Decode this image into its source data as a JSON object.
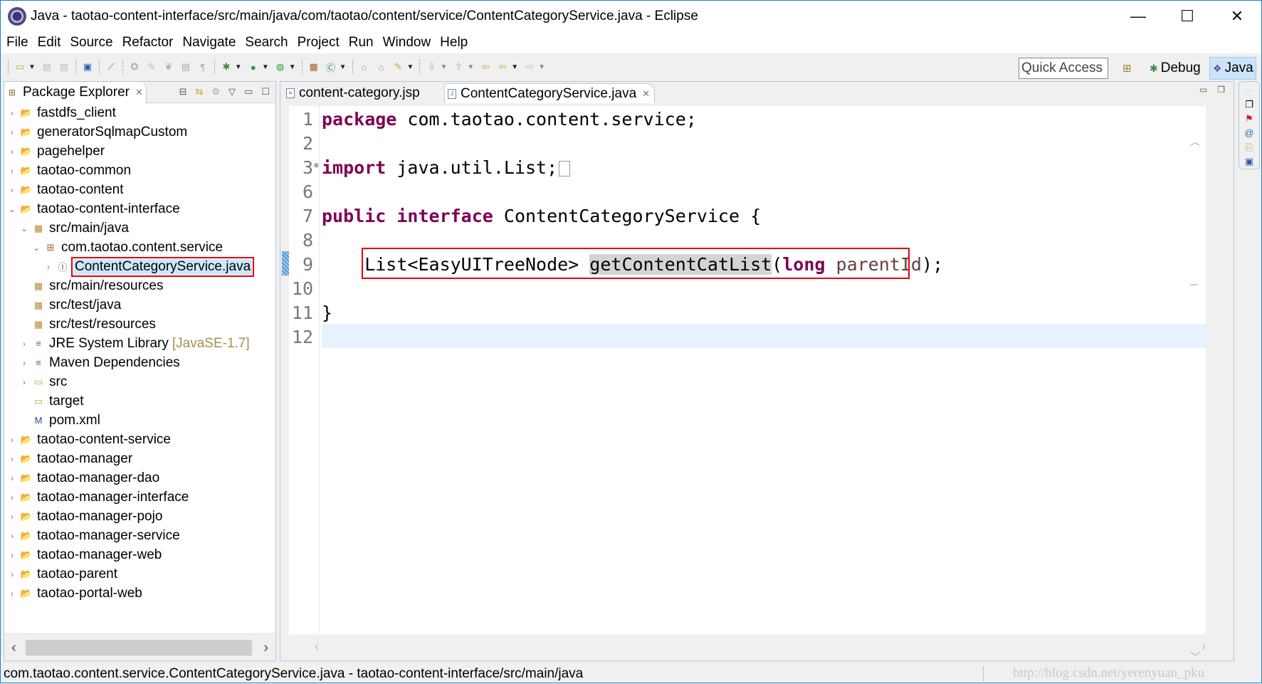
{
  "window": {
    "title": "Java - taotao-content-interface/src/main/java/com/taotao/content/service/ContentCategoryService.java - Eclipse",
    "minimize": "—",
    "maximize": "☐",
    "close": "✕"
  },
  "menu": [
    "File",
    "Edit",
    "Source",
    "Refactor",
    "Navigate",
    "Search",
    "Project",
    "Run",
    "Window",
    "Help"
  ],
  "toolbar": {
    "quick_access": "Quick Access",
    "perspectives": {
      "open": "⊞",
      "debug": "Debug",
      "java": "Java"
    }
  },
  "package_explorer": {
    "title": "Package Explorer",
    "tree": [
      {
        "label": "fastdfs_client",
        "level": 0,
        "expand": ">",
        "icon": "maven-project-warning"
      },
      {
        "label": "generatorSqlmapCustom",
        "level": 0,
        "expand": ">",
        "icon": "java-project-warning"
      },
      {
        "label": "pagehelper",
        "level": 0,
        "expand": ">",
        "icon": "maven-project"
      },
      {
        "label": "taotao-common",
        "level": 0,
        "expand": ">",
        "icon": "maven-project-warning"
      },
      {
        "label": "taotao-content",
        "level": 0,
        "expand": ">",
        "icon": "maven-project-warning"
      },
      {
        "label": "taotao-content-interface",
        "level": 0,
        "expand": "v",
        "icon": "maven-project"
      },
      {
        "label": "src/main/java",
        "level": 1,
        "expand": "v",
        "icon": "source-folder"
      },
      {
        "label": "com.taotao.content.service",
        "level": 2,
        "expand": "v",
        "icon": "package"
      },
      {
        "label": "ContentCategoryService.java",
        "level": 3,
        "expand": ">",
        "icon": "interface-file",
        "selected": true
      },
      {
        "label": "src/main/resources",
        "level": 1,
        "expand": "",
        "icon": "source-folder"
      },
      {
        "label": "src/test/java",
        "level": 1,
        "expand": "",
        "icon": "source-folder"
      },
      {
        "label": "src/test/resources",
        "level": 1,
        "expand": "",
        "icon": "source-folder"
      },
      {
        "label": "JRE System Library",
        "decoration": "[JavaSE-1.7]",
        "level": 1,
        "expand": ">",
        "icon": "library"
      },
      {
        "label": "Maven Dependencies",
        "level": 1,
        "expand": ">",
        "icon": "library"
      },
      {
        "label": "src",
        "level": 1,
        "expand": ">",
        "icon": "folder"
      },
      {
        "label": "target",
        "level": 1,
        "expand": "",
        "icon": "folder"
      },
      {
        "label": "pom.xml",
        "level": 1,
        "expand": "",
        "icon": "maven-file"
      },
      {
        "label": "taotao-content-service",
        "level": 0,
        "expand": ">",
        "icon": "maven-project-warning"
      },
      {
        "label": "taotao-manager",
        "level": 0,
        "expand": ">",
        "icon": "maven-project-warning"
      },
      {
        "label": "taotao-manager-dao",
        "level": 0,
        "expand": ">",
        "icon": "maven-project-warning"
      },
      {
        "label": "taotao-manager-interface",
        "level": 0,
        "expand": ">",
        "icon": "maven-project-warning"
      },
      {
        "label": "taotao-manager-pojo",
        "level": 0,
        "expand": ">",
        "icon": "maven-project-warning"
      },
      {
        "label": "taotao-manager-service",
        "level": 0,
        "expand": ">",
        "icon": "maven-project-warning"
      },
      {
        "label": "taotao-manager-web",
        "level": 0,
        "expand": ">",
        "icon": "maven-project-warning"
      },
      {
        "label": "taotao-parent",
        "level": 0,
        "expand": ">",
        "icon": "maven-project"
      },
      {
        "label": "taotao-portal-web",
        "level": 0,
        "expand": ">",
        "icon": "maven-project-warning"
      }
    ]
  },
  "editor": {
    "tabs": [
      {
        "label": "content-category.jsp",
        "active": false
      },
      {
        "label": "ContentCategoryService.java",
        "active": true
      }
    ],
    "lines": [
      {
        "num": "1",
        "tokens": [
          {
            "t": "package",
            "c": "kw"
          },
          {
            "t": " com.taotao.content.service;"
          }
        ]
      },
      {
        "num": "2",
        "tokens": []
      },
      {
        "num": "3",
        "fold": "⊕",
        "tokens": [
          {
            "t": "import",
            "c": "kw"
          },
          {
            "t": " java.util.List;"
          }
        ],
        "folded": true
      },
      {
        "num": "6",
        "tokens": []
      },
      {
        "num": "7",
        "tokens": [
          {
            "t": "public",
            "c": "kw"
          },
          {
            "t": " "
          },
          {
            "t": "interface",
            "c": "kw"
          },
          {
            "t": " ContentCategoryService {"
          }
        ]
      },
      {
        "num": "8",
        "tokens": []
      },
      {
        "num": "9",
        "tokens": [
          {
            "t": "    List<EasyUITreeNode> "
          },
          {
            "t": "getContentCatList",
            "c": "occurrence"
          },
          {
            "t": "("
          },
          {
            "t": "long",
            "c": "kw"
          },
          {
            "t": " "
          },
          {
            "t": "parentId",
            "c": "param"
          },
          {
            "t": ");"
          }
        ],
        "changed": true
      },
      {
        "num": "10",
        "tokens": []
      },
      {
        "num": "11",
        "tokens": [
          {
            "t": "}"
          }
        ]
      },
      {
        "num": "12",
        "tokens": [],
        "current": true
      }
    ]
  },
  "status_bar": {
    "text": "com.taotao.content.service.ContentCategoryService.java - taotao-content-interface/src/main/java",
    "watermark": "http://blog.csdn.net/yerenyuan_pku"
  }
}
